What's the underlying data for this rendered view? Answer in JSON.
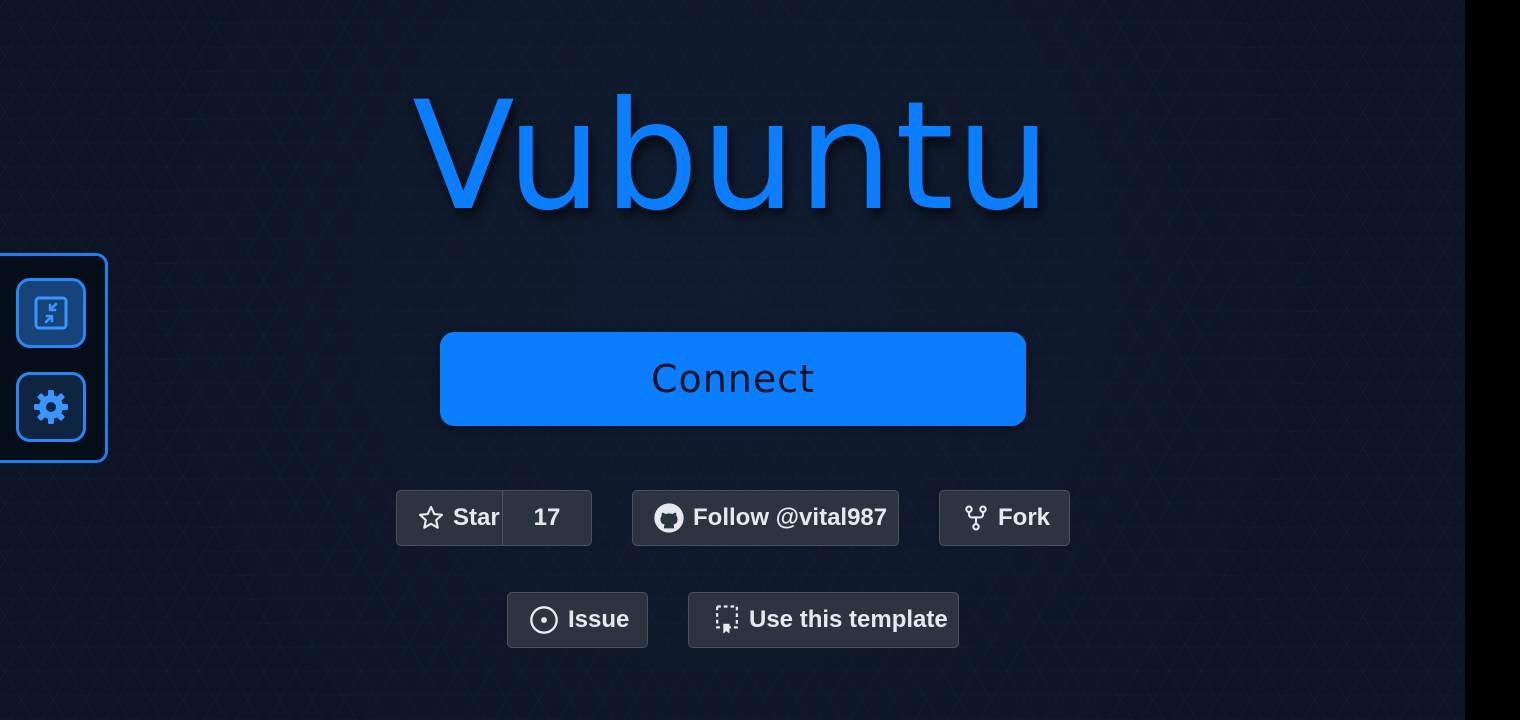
{
  "app": {
    "title": "Vubuntu"
  },
  "controls": {
    "fullscreen_icon": "fullscreen-exit-icon",
    "settings_icon": "gear-icon"
  },
  "connect": {
    "label": "Connect"
  },
  "github": {
    "star_label": "Star",
    "star_count": "17",
    "follow_label": "Follow @vital987",
    "fork_label": "Fork",
    "issue_label": "Issue",
    "template_label": "Use this template"
  },
  "colors": {
    "accent": "#0a7eff",
    "background": "#0c1524",
    "button_bg": "#2c3440",
    "button_border": "#4a5260"
  }
}
